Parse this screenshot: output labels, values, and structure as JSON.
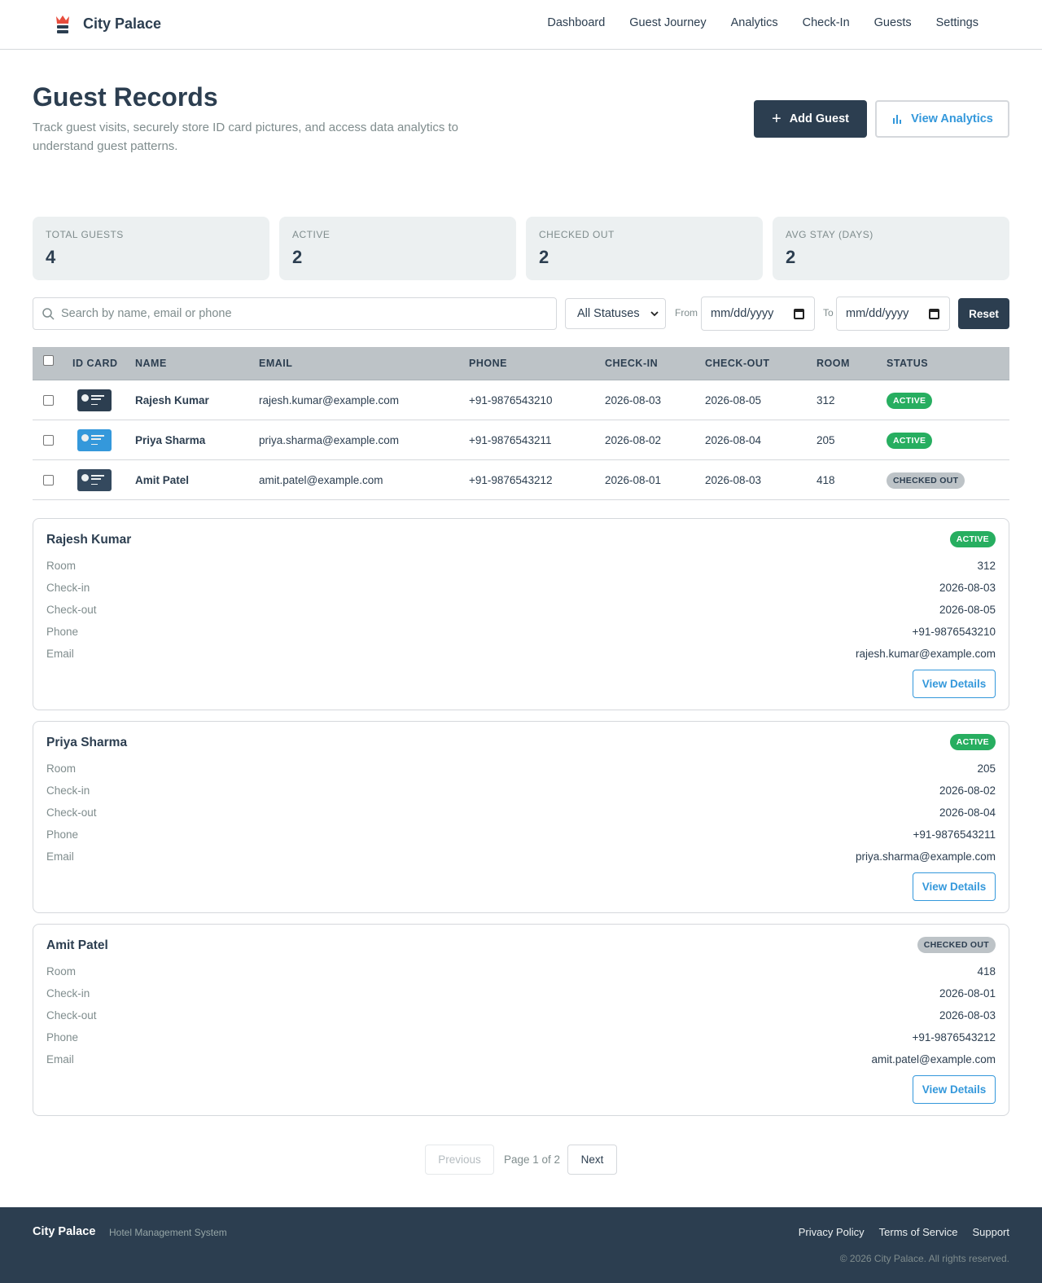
{
  "brand": {
    "name": "City Palace"
  },
  "nav": [
    "Dashboard",
    "Guest Journey",
    "Analytics",
    "Check-In",
    "Guests",
    "Settings"
  ],
  "header": {
    "title": "Guest Records",
    "subtitle": "Track guest visits, securely store ID card pictures, and access data analytics to understand guest patterns.",
    "add_label": "Add Guest",
    "analytics_label": "View Analytics"
  },
  "stats": [
    {
      "label": "TOTAL GUESTS",
      "value": "4"
    },
    {
      "label": "ACTIVE",
      "value": "2"
    },
    {
      "label": "CHECKED OUT",
      "value": "2"
    },
    {
      "label": "AVG STAY (DAYS)",
      "value": "2"
    }
  ],
  "filters": {
    "search_placeholder": "Search by name, email or phone",
    "status_value": "All Statuses",
    "from_label": "From",
    "to_label": "To",
    "date_placeholder": "mm/dd/yyyy",
    "reset_label": "Reset"
  },
  "table": {
    "headers": [
      "ID CARD",
      "NAME",
      "EMAIL",
      "PHONE",
      "CHECK-IN",
      "CHECK-OUT",
      "ROOM",
      "STATUS"
    ],
    "rows": [
      {
        "name": "Rajesh Kumar",
        "email": "rajesh.kumar@example.com",
        "phone": "+91-9876543210",
        "checkin": "2026-08-03",
        "checkout": "2026-08-05",
        "room": "312",
        "status": "ACTIVE",
        "card_color": "#2c3e50"
      },
      {
        "name": "Priya Sharma",
        "email": "priya.sharma@example.com",
        "phone": "+91-9876543211",
        "checkin": "2026-08-02",
        "checkout": "2026-08-04",
        "room": "205",
        "status": "ACTIVE",
        "card_color": "#3498db"
      },
      {
        "name": "Amit Patel",
        "email": "amit.patel@example.com",
        "phone": "+91-9876543212",
        "checkin": "2026-08-01",
        "checkout": "2026-08-03",
        "room": "418",
        "status": "CHECKED OUT",
        "card_color": "#34495e"
      }
    ]
  },
  "card_labels": {
    "room": "Room",
    "checkin": "Check-in",
    "checkout": "Check-out",
    "phone": "Phone",
    "email": "Email",
    "details": "View Details"
  },
  "pagination": {
    "prev": "Previous",
    "info": "Page 1 of 2",
    "next": "Next"
  },
  "footer": {
    "brand": "City Palace",
    "tagline": "Hotel Management System",
    "links": [
      "Privacy Policy",
      "Terms of Service",
      "Support"
    ],
    "copyright": "© 2026 City Palace. All rights reserved."
  },
  "colors": {
    "primary": "#2c3e50",
    "accent": "#3498db",
    "active": "#27ae60",
    "checked_out": "#bdc3c7",
    "brand_icon": "#e74c3c"
  }
}
